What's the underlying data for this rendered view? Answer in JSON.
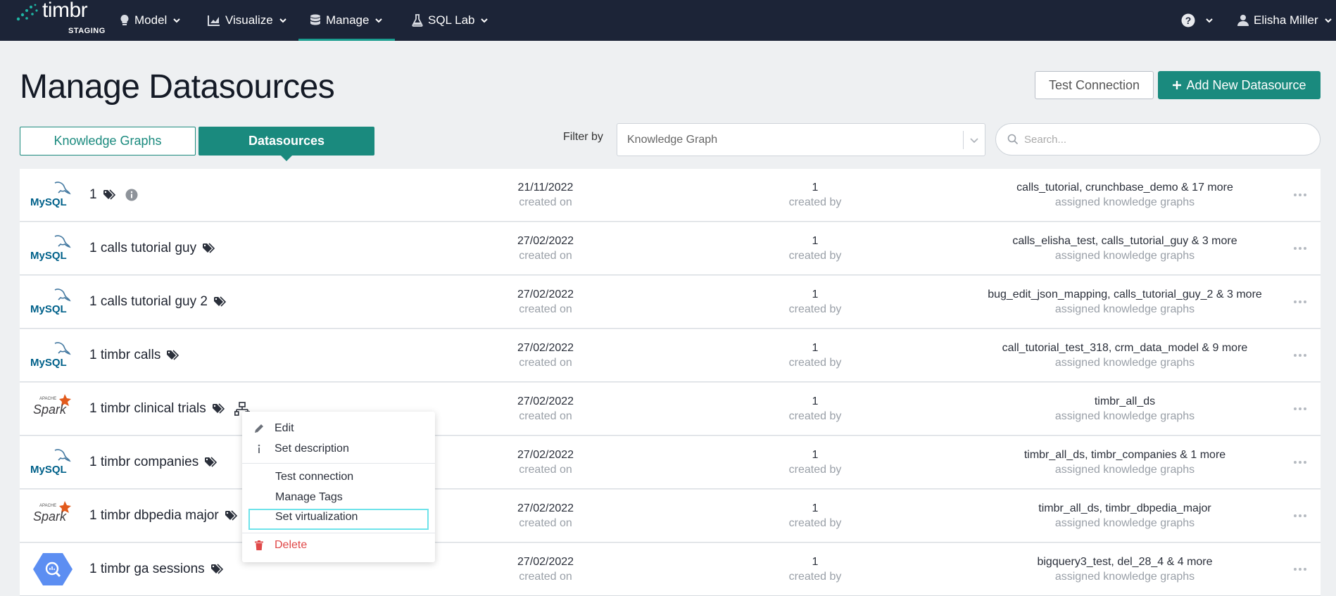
{
  "nav": {
    "brand": "timbr",
    "brand_sub": "STAGING",
    "items": [
      {
        "label": "Model",
        "icon": "lightbulb-icon"
      },
      {
        "label": "Visualize",
        "icon": "chart-icon"
      },
      {
        "label": "Manage",
        "icon": "database-icon",
        "active": true
      },
      {
        "label": "SQL Lab",
        "icon": "flask-icon"
      }
    ],
    "user": "Elisha Miller"
  },
  "header": {
    "title": "Manage Datasources",
    "test_connection": "Test Connection",
    "add_new": "Add New Datasource"
  },
  "tabs": {
    "knowledge_graphs": "Knowledge Graphs",
    "datasources": "Datasources"
  },
  "filter": {
    "label": "Filter by",
    "value": "Knowledge Graph"
  },
  "search": {
    "placeholder": "Search..."
  },
  "column_labels": {
    "created_on": "created on",
    "created_by": "created by",
    "assigned": "assigned knowledge graphs"
  },
  "rows": [
    {
      "type": "mysql",
      "name": "1",
      "tag": true,
      "info": true,
      "date": "21/11/2022",
      "by": "1",
      "kgs": "calls_tutorial, crunchbase_demo & 17 more"
    },
    {
      "type": "mysql",
      "name": "1 calls tutorial guy",
      "tag": true,
      "date": "27/02/2022",
      "by": "1",
      "kgs": "calls_elisha_test, calls_tutorial_guy & 3 more"
    },
    {
      "type": "mysql",
      "name": "1 calls tutorial guy 2",
      "tag": true,
      "date": "27/02/2022",
      "by": "1",
      "kgs": "bug_edit_json_mapping, calls_tutorial_guy_2 & 3 more"
    },
    {
      "type": "mysql",
      "name": "1 timbr calls",
      "tag": true,
      "date": "27/02/2022",
      "by": "1",
      "kgs": "call_tutorial_test_318, crm_data_model & 9 more"
    },
    {
      "type": "spark",
      "name": "1 timbr clinical trials",
      "tag": true,
      "virt": true,
      "date": "27/02/2022",
      "by": "1",
      "kgs": "timbr_all_ds"
    },
    {
      "type": "mysql",
      "name": "1 timbr companies",
      "tag": true,
      "date": "27/02/2022",
      "by": "1",
      "kgs": "timbr_all_ds, timbr_companies & 1 more"
    },
    {
      "type": "spark",
      "name": "1 timbr dbpedia major",
      "tag": true,
      "date": "27/02/2022",
      "by": "1",
      "kgs": "timbr_all_ds, timbr_dbpedia_major"
    },
    {
      "type": "bigquery",
      "name": "1 timbr ga sessions",
      "tag": true,
      "date": "27/02/2022",
      "by": "1",
      "kgs": "bigquery3_test, del_28_4 & 4 more"
    }
  ],
  "logos": {
    "mysql": "MySQL",
    "spark_small": "APACHE",
    "spark": "Spark"
  },
  "context_menu": {
    "edit": "Edit",
    "set_description": "Set description",
    "test_connection": "Test connection",
    "manage_tags": "Manage Tags",
    "set_virtualization": "Set virtualization",
    "delete": "Delete"
  },
  "colors": {
    "nav_bg": "#1c2437",
    "accent": "#1a8a7e",
    "danger": "#e04848"
  }
}
